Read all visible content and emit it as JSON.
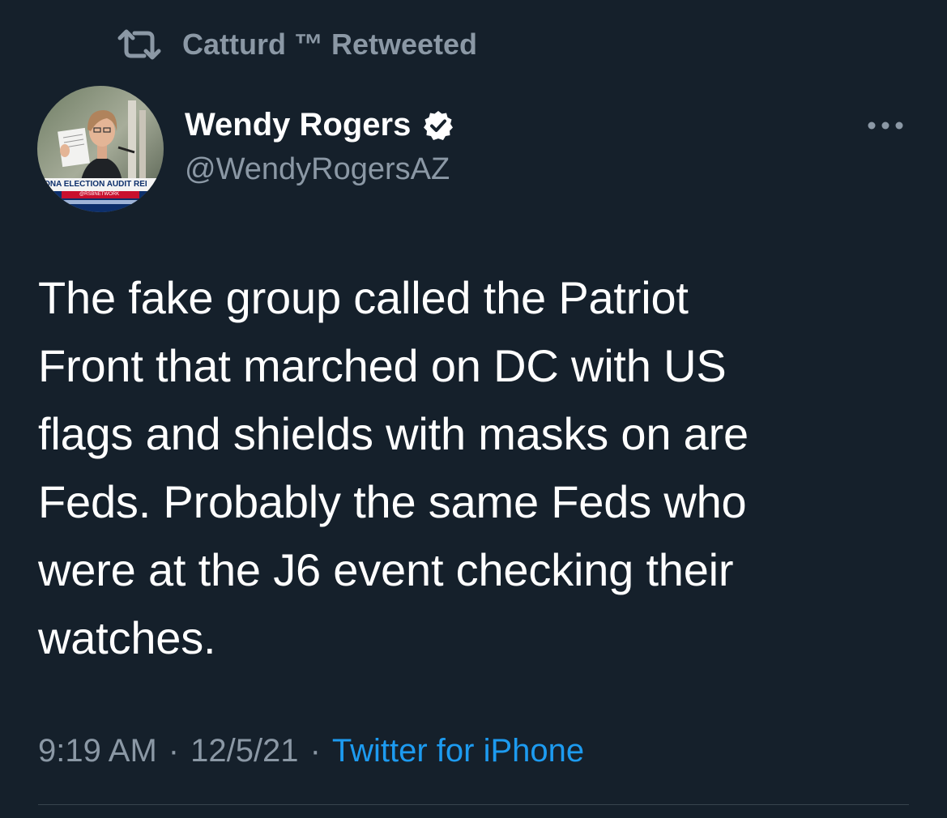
{
  "retweet_banner": {
    "icon": "retweet-icon",
    "label": "Catturd ™ Retweeted"
  },
  "author": {
    "name": "Wendy Rogers",
    "handle": "@WendyRogersAZ",
    "verified_icon": "verified-badge-icon",
    "avatar": {
      "banner_text": "ZONA ELECTION AUDIT REI",
      "sub_text": "@RSBNETWORK"
    }
  },
  "more_icon": "more-options-icon",
  "tweet": {
    "lines": [
      "The fake group called the Patriot",
      "Front that marched on DC with US",
      "flags and shields with masks on are",
      "Feds. Probably the same Feds who",
      "were at the J6 event checking their",
      "watches."
    ]
  },
  "meta": {
    "time": "9:19 AM",
    "separator": "·",
    "date": "12/5/21",
    "source": "Twitter for iPhone"
  },
  "colors": {
    "background": "#15202b",
    "primary_text": "#ffffff",
    "secondary_text": "#8b98a5",
    "link": "#1d9bf0",
    "divider": "#38444d"
  }
}
